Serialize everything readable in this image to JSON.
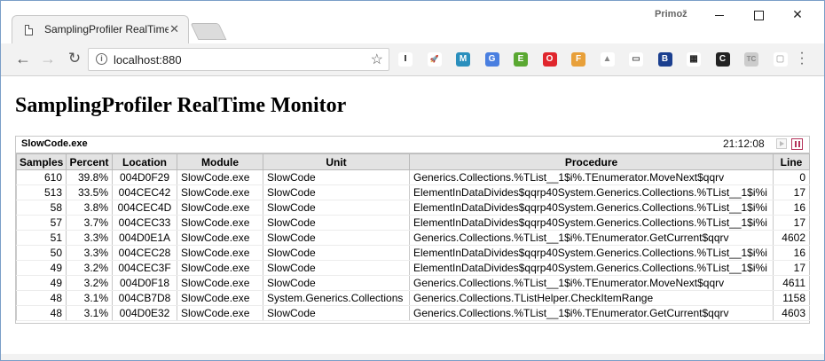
{
  "browser": {
    "tab_title": "SamplingProfiler RealTime Monitor",
    "tab_close": "✕",
    "user_name": "Primož",
    "url": "localhost:880"
  },
  "icons": {
    "back": "arrow-left-icon",
    "forward": "arrow-right-icon",
    "reload": "reload-icon",
    "info": "info-icon",
    "star": "star-icon"
  },
  "extensions": [
    {
      "name": "instapaper-icon",
      "glyph": "I",
      "color": "#ffffff",
      "fg": "#000000"
    },
    {
      "name": "rocket-icon",
      "glyph": "🚀",
      "color": "#ffffff",
      "fg": "#333333"
    },
    {
      "name": "speech-icon",
      "glyph": "M",
      "color": "#2a8fbd",
      "fg": "#ffffff"
    },
    {
      "name": "translate-icon",
      "glyph": "G",
      "color": "#4a7fe0",
      "fg": "#ffffff"
    },
    {
      "name": "evernote-icon",
      "glyph": "E",
      "color": "#5aa832",
      "fg": "#ffffff"
    },
    {
      "name": "opera-icon",
      "glyph": "O",
      "color": "#e0262d",
      "fg": "#ffffff"
    },
    {
      "name": "fox-icon",
      "glyph": "F",
      "color": "#e8a03a",
      "fg": "#ffffff"
    },
    {
      "name": "drive-icon",
      "glyph": "▲",
      "color": "#ffffff",
      "fg": "#888888"
    },
    {
      "name": "cast-icon",
      "glyph": "▭",
      "color": "#ffffff",
      "fg": "#555555"
    },
    {
      "name": "b-icon",
      "glyph": "B",
      "color": "#1b3f8f",
      "fg": "#ffffff"
    },
    {
      "name": "qr-icon",
      "glyph": "▦",
      "color": "#ffffff",
      "fg": "#222222"
    },
    {
      "name": "c-icon",
      "glyph": "C",
      "color": "#222222",
      "fg": "#ffffff"
    },
    {
      "name": "tc-icon",
      "glyph": "TC",
      "color": "#cccccc",
      "fg": "#888888"
    },
    {
      "name": "screen-icon",
      "glyph": "▢",
      "color": "#ffffff",
      "fg": "#bbbbbb"
    }
  ],
  "page": {
    "title": "SamplingProfiler RealTime Monitor",
    "process": "SlowCode.exe",
    "time": "21:12:08"
  },
  "table": {
    "columns": [
      "Samples",
      "Percent",
      "Location",
      "Module",
      "Unit",
      "Procedure",
      "Line"
    ],
    "rows": [
      [
        "610",
        "39.8%",
        "004D0F29",
        "SlowCode.exe",
        "SlowCode",
        "Generics.Collections.%TList__1$i%.TEnumerator.MoveNext$qqrv",
        "0"
      ],
      [
        "513",
        "33.5%",
        "004CEC42",
        "SlowCode.exe",
        "SlowCode",
        "ElementInDataDivides$qqrp40System.Generics.Collections.%TList__1$i%i",
        "17"
      ],
      [
        "58",
        "3.8%",
        "004CEC4D",
        "SlowCode.exe",
        "SlowCode",
        "ElementInDataDivides$qqrp40System.Generics.Collections.%TList__1$i%i",
        "16"
      ],
      [
        "57",
        "3.7%",
        "004CEC33",
        "SlowCode.exe",
        "SlowCode",
        "ElementInDataDivides$qqrp40System.Generics.Collections.%TList__1$i%i",
        "17"
      ],
      [
        "51",
        "3.3%",
        "004D0E1A",
        "SlowCode.exe",
        "SlowCode",
        "Generics.Collections.%TList__1$i%.TEnumerator.GetCurrent$qqrv",
        "4602"
      ],
      [
        "50",
        "3.3%",
        "004CEC28",
        "SlowCode.exe",
        "SlowCode",
        "ElementInDataDivides$qqrp40System.Generics.Collections.%TList__1$i%i",
        "16"
      ],
      [
        "49",
        "3.2%",
        "004CEC3F",
        "SlowCode.exe",
        "SlowCode",
        "ElementInDataDivides$qqrp40System.Generics.Collections.%TList__1$i%i",
        "17"
      ],
      [
        "49",
        "3.2%",
        "004D0F18",
        "SlowCode.exe",
        "SlowCode",
        "Generics.Collections.%TList__1$i%.TEnumerator.MoveNext$qqrv",
        "4611"
      ],
      [
        "48",
        "3.1%",
        "004CB7D8",
        "SlowCode.exe",
        "System.Generics.Collections",
        "Generics.Collections.TListHelper.CheckItemRange",
        "1158"
      ],
      [
        "48",
        "3.1%",
        "004D0E32",
        "SlowCode.exe",
        "SlowCode",
        "Generics.Collections.%TList__1$i%.TEnumerator.GetCurrent$qqrv",
        "4603"
      ]
    ]
  }
}
